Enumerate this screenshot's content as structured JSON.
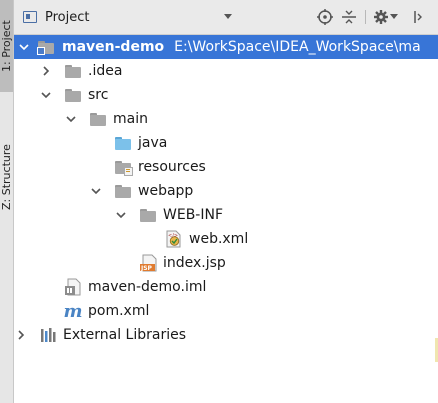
{
  "side_tabs": [
    {
      "label": "1: Project",
      "active": true
    },
    {
      "label": "Z: Structure",
      "active": false
    }
  ],
  "header": {
    "title": "Project",
    "buttons": [
      "locate-icon",
      "collapse-icon",
      "gear-icon",
      "hide-icon"
    ]
  },
  "tree": [
    {
      "label": "maven-demo",
      "path": "E:\\WorkSpace\\IDEA_WorkSpace\\ma",
      "bold": true,
      "selected": true,
      "expanded": true,
      "icon": "module-folder-icon"
    },
    {
      "label": ".idea",
      "expanded": false,
      "icon": "folder-icon"
    },
    {
      "label": "src",
      "expanded": true,
      "icon": "folder-icon"
    },
    {
      "label": "main",
      "expanded": true,
      "icon": "folder-icon"
    },
    {
      "label": "java",
      "icon": "source-folder-icon"
    },
    {
      "label": "resources",
      "icon": "resources-folder-icon"
    },
    {
      "label": "webapp",
      "expanded": true,
      "icon": "folder-icon"
    },
    {
      "label": "WEB-INF",
      "expanded": true,
      "icon": "folder-icon"
    },
    {
      "label": "web.xml",
      "icon": "xml-file-icon"
    },
    {
      "label": "index.jsp",
      "icon": "jsp-file-icon"
    },
    {
      "label": "maven-demo.iml",
      "icon": "iml-file-icon"
    },
    {
      "label": "pom.xml",
      "icon": "maven-icon"
    },
    {
      "label": "External Libraries",
      "expanded": false,
      "icon": "libraries-icon"
    }
  ],
  "colors": {
    "selection": "#3875d7",
    "header_bg": "#eaeaea",
    "folder": "#a9a9a9",
    "source_folder": "#7cc1ea"
  }
}
